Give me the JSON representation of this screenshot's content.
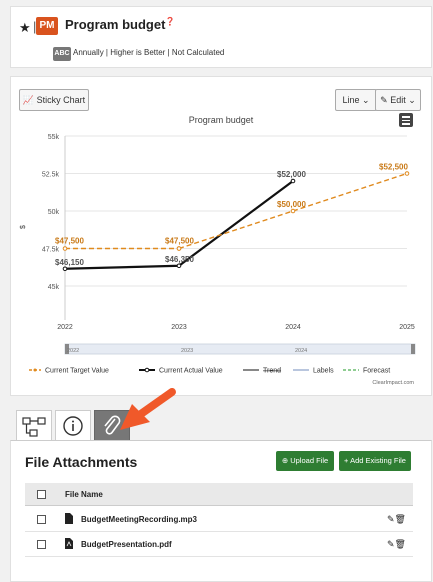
{
  "header": {
    "badge": "PM",
    "title": "Program budget",
    "type_badge": "ABC",
    "description": "Annually | Higher is Better | Not Calculated"
  },
  "toolbar": {
    "sticky_label": "Sticky Chart",
    "line_label": "Line",
    "edit_label": "Edit"
  },
  "chart_data": {
    "type": "line",
    "title": "Program budget",
    "ylabel": "$",
    "ylim": [
      43000,
      55000
    ],
    "yticks": [
      "45k",
      "47.5k",
      "50k",
      "52.5k",
      "55k"
    ],
    "x": [
      "2022",
      "2023",
      "2024",
      "2025"
    ],
    "series": [
      {
        "name": "Current Target Value",
        "x": [
          2022,
          2023
        ],
        "values": [
          47500,
          47500
        ],
        "labels": [
          "$47,500",
          "$47,500"
        ],
        "color": "#e08a1e"
      },
      {
        "name": "Current Actual Value",
        "x": [
          2022,
          2023,
          2024
        ],
        "values": [
          46150,
          46350,
          52000
        ],
        "labels": [
          "$46,150",
          "$46,350",
          "$52,000"
        ],
        "color": "#111111"
      },
      {
        "name": "Forecast",
        "x": [
          2023,
          2024,
          2025
        ],
        "values": [
          47500,
          50000,
          52500
        ],
        "labels": [
          "",
          "$50,000",
          "$52,500"
        ],
        "color": "#e08a1e"
      }
    ],
    "navigator_labels": [
      "2022",
      "2023",
      "2024"
    ],
    "legend": [
      "Current Target Value",
      "Current Actual Value",
      "Trend",
      "Labels",
      "Forecast"
    ],
    "credit": "ClearImpact.com"
  },
  "attachments": {
    "title": "File Attachments",
    "upload_label": "Upload File",
    "add_existing_label": "Add Existing File",
    "column_header": "File Name",
    "files": [
      {
        "name": "BudgetMeetingRecording.mp3"
      },
      {
        "name": "BudgetPresentation.pdf"
      }
    ]
  },
  "colors": {
    "brand": "#d9531e",
    "accent": "#e08a1e",
    "green": "#2e7d32",
    "arrow": "#f0592a"
  }
}
